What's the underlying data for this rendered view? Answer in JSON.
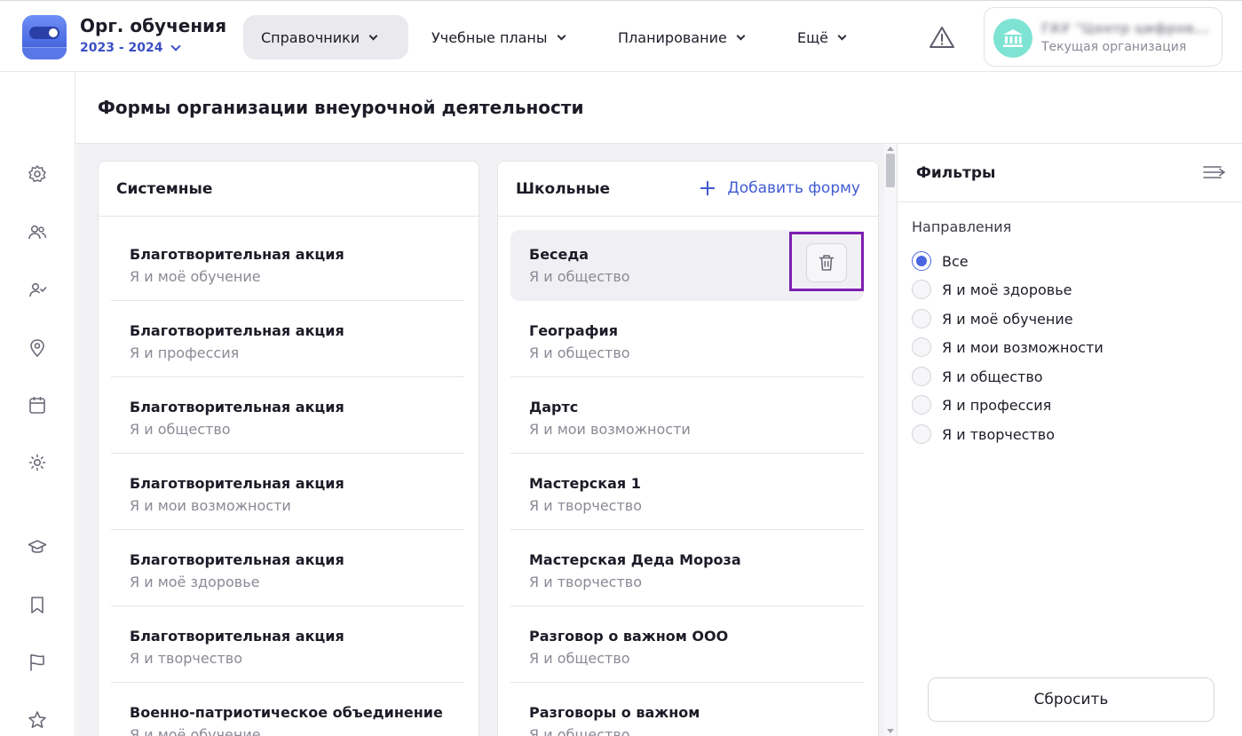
{
  "header": {
    "app_title": "Орг. обучения",
    "year": "2023 - 2024",
    "nav": [
      {
        "label": "Справочники"
      },
      {
        "label": "Учебные планы"
      },
      {
        "label": "Планирование"
      },
      {
        "label": "Ещё"
      }
    ],
    "org_name": "ГАУ \"Центр цифров...",
    "org_sub": "Текущая организация"
  },
  "page_title": "Формы организации внеурочной деятельности",
  "system": {
    "title": "Системные",
    "items": [
      {
        "name": "Благотворительная акция",
        "direction": "Я и моё обучение"
      },
      {
        "name": "Благотворительная акция",
        "direction": "Я и профессия"
      },
      {
        "name": "Благотворительная акция",
        "direction": "Я и общество"
      },
      {
        "name": "Благотворительная акция",
        "direction": "Я и мои возможности"
      },
      {
        "name": "Благотворительная акция",
        "direction": "Я и моё здоровье"
      },
      {
        "name": "Благотворительная акция",
        "direction": "Я и творчество"
      },
      {
        "name": "Военно-патриотическое объединение",
        "direction": "Я и моё обучение"
      }
    ]
  },
  "school": {
    "title": "Школьные",
    "add_label": "Добавить форму",
    "items": [
      {
        "name": "Беседа",
        "direction": "Я и общество"
      },
      {
        "name": "География",
        "direction": "Я и общество"
      },
      {
        "name": "Дартс",
        "direction": "Я и мои возможности"
      },
      {
        "name": "Мастерская 1",
        "direction": "Я и творчество"
      },
      {
        "name": "Мастерская Деда Мороза",
        "direction": "Я и творчество"
      },
      {
        "name": "Разговор о важном ООО",
        "direction": "Я и общество"
      },
      {
        "name": "Разговоры о важном",
        "direction": "Я и общество"
      }
    ]
  },
  "filters": {
    "title": "Фильтры",
    "group_label": "Направления",
    "options": [
      {
        "label": "Все",
        "checked": true
      },
      {
        "label": "Я и моё здоровье",
        "checked": false
      },
      {
        "label": "Я и моё обучение",
        "checked": false
      },
      {
        "label": "Я и мои возможности",
        "checked": false
      },
      {
        "label": "Я и общество",
        "checked": false
      },
      {
        "label": "Я и профессия",
        "checked": false
      },
      {
        "label": "Я и творчество",
        "checked": false
      }
    ],
    "reset_label": "Сбросить"
  },
  "icons": {
    "rail": [
      "gear-icon",
      "users-icon",
      "user-check-icon",
      "location-pin-icon",
      "calendar-icon",
      "sun-icon",
      "graduation-cap-icon",
      "bookmark-icon",
      "flag-icon",
      "star-icon"
    ],
    "delete": "trash-icon",
    "alert": "warning-icon",
    "org": "bank-icon"
  },
  "colors": {
    "accent": "#3f5bd4",
    "highlight_border": "#7d1fb0",
    "org_avatar": "#7fe3d4"
  }
}
